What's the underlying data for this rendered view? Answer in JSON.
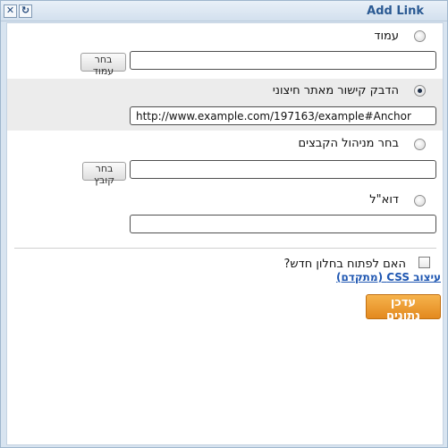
{
  "window": {
    "title": "Add Link",
    "close_icon": "close-icon",
    "refresh_icon": "refresh-icon"
  },
  "options": {
    "page": {
      "label": "עמוד",
      "button": "בחר עמוד",
      "value": ""
    },
    "external": {
      "label": "הדבק קישור מאתר חיצוני",
      "value": "http://www.example.com/197163/example#Anchor"
    },
    "file": {
      "label": "בחר מניהול הקבצים",
      "button": "בחר קובץ",
      "value": ""
    },
    "email": {
      "label": "דוא\"ל",
      "value": ""
    }
  },
  "selected_option": "external",
  "open_new_window": {
    "label": "האם לפתוח בחלון חדש?",
    "checked": false
  },
  "css_link": "עיצוב CSS (מתקדם)",
  "update_button": "עדכן נתונים",
  "colors": {
    "title": "#2b5a93",
    "link": "#1f57b2",
    "primary": "#e3891f",
    "selected_row": "#ececec"
  }
}
